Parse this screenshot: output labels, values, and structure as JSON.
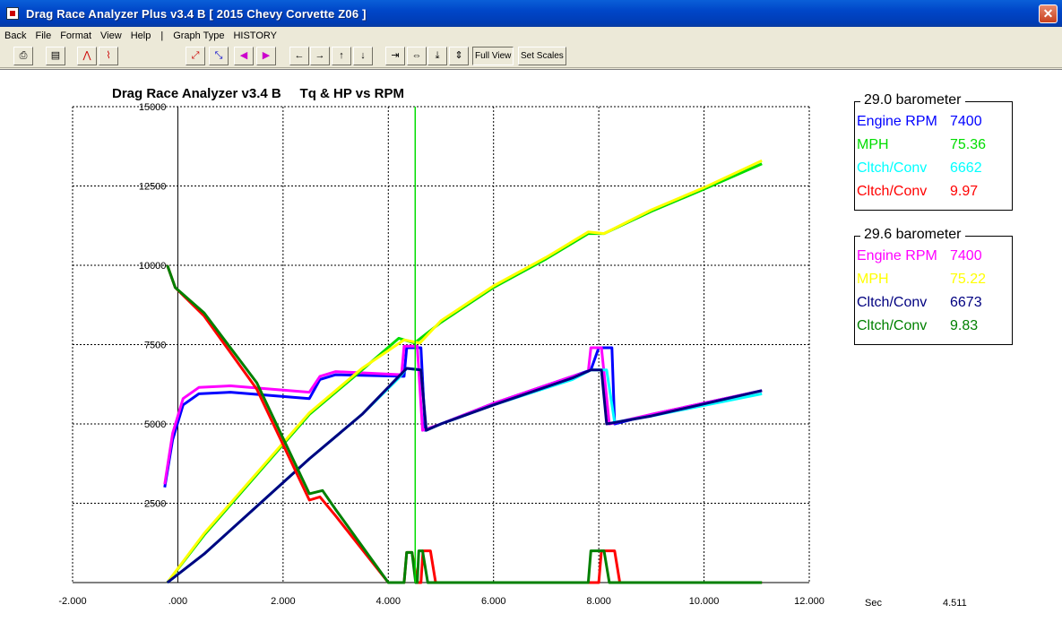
{
  "window": {
    "title": "Drag Race Analyzer Plus v3.4 B [ 2015 Chevy Corvette Z06 ]",
    "close_glyph": "✕"
  },
  "menu": [
    "Back",
    "File",
    "Format",
    "View",
    "Help",
    "|",
    "Graph Type",
    "HISTORY"
  ],
  "toolbar": {
    "full_view_label": "Full View",
    "set_scales_label": "Set Scales",
    "icons": [
      "print-icon",
      "save-icon",
      "chart-a-icon",
      "chart-b-icon",
      "graph-add-icon",
      "graph-compare-icon",
      "step-left-icon",
      "step-right-icon",
      "pan-left-icon",
      "pan-right-icon",
      "pan-up-icon",
      "pan-down-icon",
      "zoom-in-x-icon",
      "zoom-out-x-icon",
      "zoom-in-y-icon",
      "zoom-out-y-icon"
    ]
  },
  "chart_data": {
    "type": "line",
    "title": "Drag Race Analyzer v3.4 B     Tq & HP vs RPM",
    "xlim": [
      -2.0,
      12.0
    ],
    "ylim": [
      0,
      15000
    ],
    "x_ticks": [
      "-2.000",
      ".000",
      "2.000",
      "4.000",
      "6.000",
      "8.000",
      "10.000",
      "12.000"
    ],
    "y_ticks": [
      "15000",
      "12500",
      "10000",
      "7500",
      "5000",
      "2500"
    ],
    "grid": true,
    "cursor_x": 4.511,
    "series": [
      {
        "name": "Engine RPM (29.0)",
        "color": "#0000ff",
        "points": [
          [
            -0.25,
            3000
          ],
          [
            -0.1,
            4500
          ],
          [
            0.1,
            5600
          ],
          [
            0.4,
            5950
          ],
          [
            1.0,
            6000
          ],
          [
            2.5,
            5800
          ],
          [
            2.7,
            6400
          ],
          [
            3.0,
            6550
          ],
          [
            4.3,
            6500
          ],
          [
            4.35,
            7400
          ],
          [
            4.62,
            7400
          ],
          [
            4.7,
            4800
          ],
          [
            5.0,
            5000
          ],
          [
            6.0,
            5650
          ],
          [
            7.5,
            6500
          ],
          [
            7.85,
            6700
          ],
          [
            8.0,
            7400
          ],
          [
            8.25,
            7400
          ],
          [
            8.3,
            5000
          ],
          [
            9.0,
            5300
          ],
          [
            11.1,
            6050
          ]
        ]
      },
      {
        "name": "Engine RPM (29.6)",
        "color": "#ff00ff",
        "points": [
          [
            -0.25,
            3100
          ],
          [
            -0.1,
            4700
          ],
          [
            0.1,
            5800
          ],
          [
            0.4,
            6150
          ],
          [
            1.0,
            6200
          ],
          [
            2.5,
            6000
          ],
          [
            2.7,
            6500
          ],
          [
            3.0,
            6650
          ],
          [
            4.25,
            6550
          ],
          [
            4.3,
            7450
          ],
          [
            4.55,
            7450
          ],
          [
            4.65,
            4800
          ],
          [
            5.0,
            5000
          ],
          [
            6.0,
            5650
          ],
          [
            7.5,
            6500
          ],
          [
            7.8,
            6650
          ],
          [
            7.85,
            7400
          ],
          [
            8.05,
            7400
          ],
          [
            8.2,
            5000
          ],
          [
            9.0,
            5300
          ],
          [
            11.1,
            6050
          ]
        ]
      },
      {
        "name": "MPH (29.0)",
        "color": "#00dd00",
        "points": [
          [
            -0.2,
            0
          ],
          [
            0.5,
            1500
          ],
          [
            1.5,
            3400
          ],
          [
            2.5,
            5300
          ],
          [
            3.5,
            6700
          ],
          [
            4.2,
            7700
          ],
          [
            4.5,
            7550
          ],
          [
            5.0,
            8200
          ],
          [
            6.0,
            9300
          ],
          [
            7.0,
            10200
          ],
          [
            7.8,
            11000
          ],
          [
            8.1,
            11000
          ],
          [
            9.0,
            11700
          ],
          [
            10.0,
            12400
          ],
          [
            11.1,
            13200
          ]
        ]
      },
      {
        "name": "MPH (29.6)",
        "color": "#ffff00",
        "points": [
          [
            -0.2,
            0
          ],
          [
            0.5,
            1550
          ],
          [
            1.5,
            3450
          ],
          [
            2.5,
            5350
          ],
          [
            3.5,
            6750
          ],
          [
            4.3,
            7650
          ],
          [
            4.6,
            7550
          ],
          [
            5.0,
            8250
          ],
          [
            6.0,
            9350
          ],
          [
            7.0,
            10250
          ],
          [
            7.8,
            11050
          ],
          [
            8.1,
            11000
          ],
          [
            9.0,
            11750
          ],
          [
            10.0,
            12450
          ],
          [
            11.1,
            13300
          ]
        ]
      },
      {
        "name": "Cltch/Conv RPM (29.0)",
        "color": "#00ffff",
        "points": [
          [
            -0.2,
            0
          ],
          [
            0.5,
            900
          ],
          [
            1.5,
            2400
          ],
          [
            2.5,
            3900
          ],
          [
            3.5,
            5300
          ],
          [
            4.2,
            6450
          ],
          [
            4.35,
            6750
          ],
          [
            4.62,
            6700
          ],
          [
            4.72,
            4800
          ],
          [
            5.0,
            5000
          ],
          [
            6.0,
            5600
          ],
          [
            7.5,
            6400
          ],
          [
            7.85,
            6700
          ],
          [
            8.15,
            6700
          ],
          [
            8.3,
            5050
          ],
          [
            9.0,
            5250
          ],
          [
            11.1,
            5950
          ]
        ]
      },
      {
        "name": "Cltch/Conv RPM (29.6)",
        "color": "#000080",
        "points": [
          [
            -0.2,
            0
          ],
          [
            0.5,
            900
          ],
          [
            1.5,
            2400
          ],
          [
            2.5,
            3900
          ],
          [
            3.5,
            5300
          ],
          [
            4.2,
            6500
          ],
          [
            4.35,
            6750
          ],
          [
            4.62,
            6700
          ],
          [
            4.72,
            4800
          ],
          [
            5.0,
            5000
          ],
          [
            6.0,
            5600
          ],
          [
            7.5,
            6450
          ],
          [
            7.85,
            6700
          ],
          [
            8.05,
            6700
          ],
          [
            8.15,
            5000
          ],
          [
            9.0,
            5250
          ],
          [
            11.1,
            6050
          ]
        ]
      },
      {
        "name": "Cltch/Conv ET (29.0)",
        "color": "#ff0000",
        "points": [
          [
            -0.2,
            10000
          ],
          [
            -0.05,
            9300
          ],
          [
            0.5,
            8400
          ],
          [
            1.5,
            6100
          ],
          [
            2.5,
            2600
          ],
          [
            2.7,
            2700
          ],
          [
            3.0,
            2100
          ],
          [
            4.0,
            0
          ],
          [
            4.3,
            0
          ],
          [
            4.35,
            950
          ],
          [
            4.45,
            950
          ],
          [
            4.55,
            0
          ],
          [
            4.62,
            0
          ],
          [
            4.66,
            1000
          ],
          [
            4.8,
            1000
          ],
          [
            4.9,
            0
          ],
          [
            8.0,
            0
          ],
          [
            8.05,
            1000
          ],
          [
            8.3,
            1000
          ],
          [
            8.4,
            0
          ],
          [
            11.1,
            0
          ]
        ]
      },
      {
        "name": "Cltch/Conv ET (29.6)",
        "color": "#008000",
        "points": [
          [
            -0.2,
            10000
          ],
          [
            -0.05,
            9300
          ],
          [
            0.5,
            8500
          ],
          [
            1.5,
            6300
          ],
          [
            2.5,
            2800
          ],
          [
            2.75,
            2900
          ],
          [
            3.0,
            2300
          ],
          [
            4.0,
            0
          ],
          [
            4.3,
            0
          ],
          [
            4.35,
            950
          ],
          [
            4.45,
            950
          ],
          [
            4.52,
            0
          ],
          [
            4.55,
            0
          ],
          [
            4.58,
            1000
          ],
          [
            4.65,
            1000
          ],
          [
            4.75,
            0
          ],
          [
            7.8,
            0
          ],
          [
            7.85,
            1000
          ],
          [
            8.1,
            1000
          ],
          [
            8.2,
            0
          ],
          [
            11.1,
            0
          ]
        ]
      }
    ]
  },
  "legend": [
    {
      "title": "29.0 barometer",
      "rows": [
        {
          "label": "Engine RPM",
          "value": "7400",
          "color": "#0000ff"
        },
        {
          "label": "MPH",
          "value": "75.36",
          "color": "#00dd00"
        },
        {
          "label": "Cltch/Conv",
          "value": "6662",
          "color": "#00ffff"
        },
        {
          "label": "Cltch/Conv",
          "value": "9.97",
          "color": "#ff0000"
        }
      ]
    },
    {
      "title": "29.6 barometer",
      "rows": [
        {
          "label": "Engine RPM",
          "value": "7400",
          "color": "#ff00ff"
        },
        {
          "label": "MPH",
          "value": "75.22",
          "color": "#ffff00"
        },
        {
          "label": "Cltch/Conv",
          "value": "6673",
          "color": "#000080"
        },
        {
          "label": "Cltch/Conv",
          "value": "9.83",
          "color": "#008000"
        }
      ]
    }
  ],
  "status": {
    "unit_label": "Sec",
    "cursor_value": "4.511"
  }
}
